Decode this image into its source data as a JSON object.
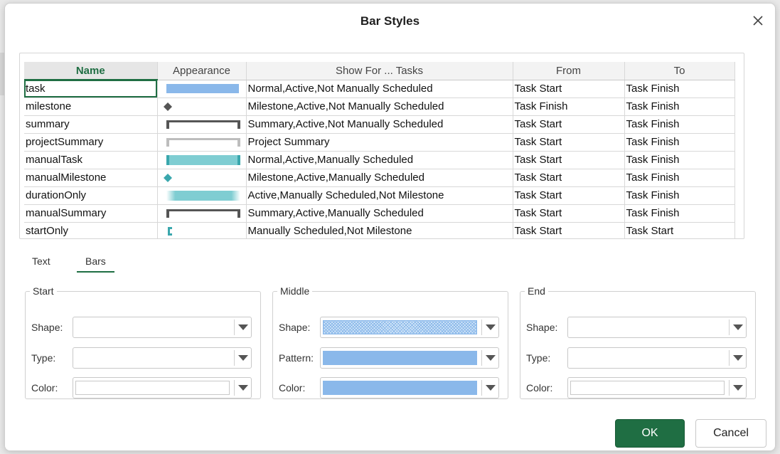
{
  "dialog": {
    "title": "Bar Styles"
  },
  "grid": {
    "columns": [
      "Name",
      "Appearance",
      "Show For ... Tasks",
      "From",
      "To"
    ],
    "rows": [
      {
        "name": "task",
        "show_for": "Normal,Active,Not Manually Scheduled",
        "from": "Task Start",
        "to": "Task Finish",
        "appearance": "solid-bar-blue"
      },
      {
        "name": "milestone",
        "show_for": "Milestone,Active,Not Manually Scheduled",
        "from": "Task Finish",
        "to": "Task Finish",
        "appearance": "diamond-gray"
      },
      {
        "name": "summary",
        "show_for": "Summary,Active,Not Manually Scheduled",
        "from": "Task Start",
        "to": "Task Finish",
        "appearance": "bracket-dark"
      },
      {
        "name": "projectSummary",
        "show_for": "Project Summary",
        "from": "Task Start",
        "to": "Task Finish",
        "appearance": "bracket-light"
      },
      {
        "name": "manualTask",
        "show_for": "Normal,Active,Manually Scheduled",
        "from": "Task Start",
        "to": "Task Finish",
        "appearance": "teal-bar-ends"
      },
      {
        "name": "manualMilestone",
        "show_for": "Milestone,Active,Manually Scheduled",
        "from": "Task Start",
        "to": "Task Finish",
        "appearance": "diamond-teal"
      },
      {
        "name": "durationOnly",
        "show_for": "Active,Manually Scheduled,Not Milestone",
        "from": "Task Start",
        "to": "Task Finish",
        "appearance": "teal-gradient-bar"
      },
      {
        "name": "manualSummary",
        "show_for": "Summary,Active,Manually Scheduled",
        "from": "Task Start",
        "to": "Task Finish",
        "appearance": "bracket-dark"
      },
      {
        "name": "startOnly",
        "show_for": "Manually Scheduled,Not Milestone",
        "from": "Task Start",
        "to": "Task Start",
        "appearance": "start-bracket-teal"
      }
    ]
  },
  "tabs": {
    "text": "Text",
    "bars": "Bars",
    "active": "Bars"
  },
  "groups": {
    "start": {
      "legend": "Start",
      "shape_label": "Shape:",
      "type_label": "Type:",
      "color_label": "Color:"
    },
    "middle": {
      "legend": "Middle",
      "shape_label": "Shape:",
      "pattern_label": "Pattern:",
      "color_label": "Color:"
    },
    "end": {
      "legend": "End",
      "shape_label": "Shape:",
      "type_label": "Type:",
      "color_label": "Color:"
    }
  },
  "buttons": {
    "ok": "OK",
    "cancel": "Cancel"
  },
  "colors": {
    "accent": "#1f6e43",
    "bar_blue": "#8ab8ea",
    "teal": "#3aa7ad",
    "teal_light": "#7fcdd2",
    "dark_gray": "#555555",
    "light_gray": "#bdbdbd"
  }
}
